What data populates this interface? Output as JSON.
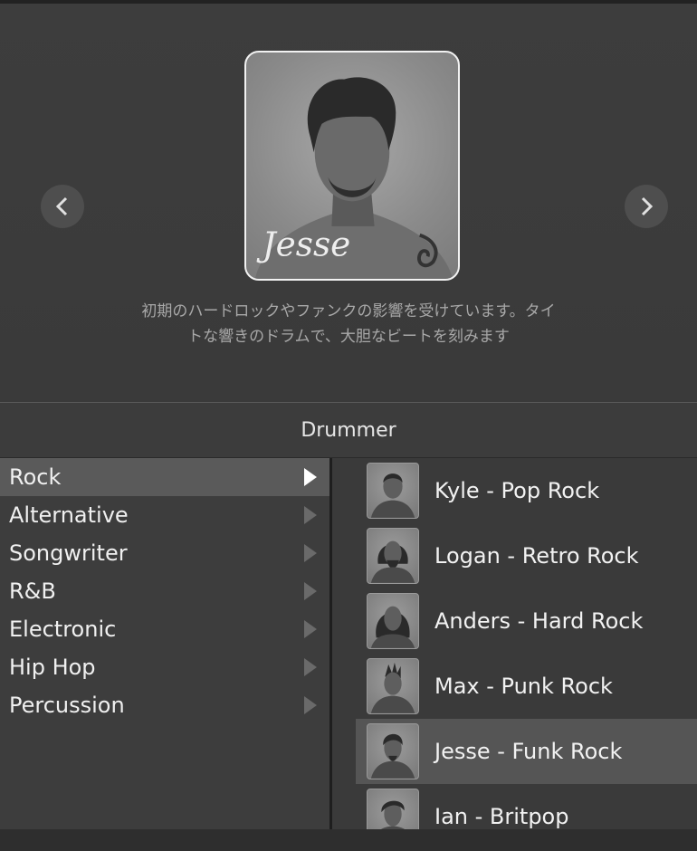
{
  "hero": {
    "description_line1": "初期のハードロックやファンクの影響を受けています。タイ",
    "description_line2": "トな響きのドラムで、大胆なビートを刻みます",
    "signature": "Jesse",
    "prev_icon": "chevron-left-icon",
    "next_icon": "chevron-right-icon"
  },
  "panel": {
    "title": "Drummer"
  },
  "genres": [
    {
      "label": "Rock",
      "selected": true
    },
    {
      "label": "Alternative"
    },
    {
      "label": "Songwriter"
    },
    {
      "label": "R&B"
    },
    {
      "label": "Electronic"
    },
    {
      "label": "Hip Hop"
    },
    {
      "label": "Percussion"
    }
  ],
  "drummers": [
    {
      "name": "Kyle - Pop Rock"
    },
    {
      "name": "Logan - Retro Rock"
    },
    {
      "name": "Anders - Hard Rock"
    },
    {
      "name": "Max - Punk Rock"
    },
    {
      "name": "Jesse - Funk Rock",
      "selected": true
    },
    {
      "name": "Ian - Britpop"
    }
  ],
  "colors": {
    "background": "#3a3a3a",
    "selection": "#5a5a5a",
    "text": "#f0f0f0",
    "muted_text": "#a8a8a8"
  }
}
